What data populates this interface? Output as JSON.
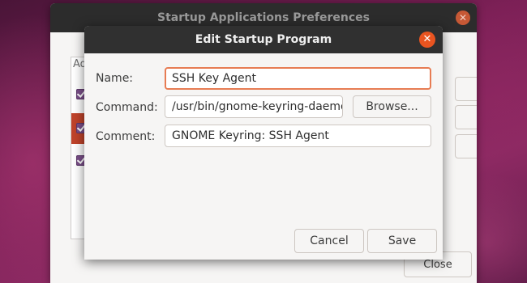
{
  "background_window": {
    "title": "Startup Applications Preferences",
    "section_label": "Ad",
    "close_button_label": "Close"
  },
  "dialog": {
    "title": "Edit Startup Program",
    "fields": {
      "name": {
        "label": "Name:",
        "value": "SSH Key Agent"
      },
      "command": {
        "label": "Command:",
        "value": "/usr/bin/gnome-keyring-daemon --start --components=ssh"
      },
      "comment": {
        "label": "Comment:",
        "value": "GNOME Keyring: SSH Agent"
      }
    },
    "browse_button_label": "Browse...",
    "cancel_button_label": "Cancel",
    "save_button_label": "Save"
  },
  "icons": {
    "window_close": "close-icon",
    "dialog_close": "close-icon",
    "checkbox_checked": "checkbox-checked-icon"
  },
  "colors": {
    "accent": "#e95420",
    "titlebar": "#303030",
    "checkbox": "#7b4f8a",
    "selection": "#c0432b"
  }
}
